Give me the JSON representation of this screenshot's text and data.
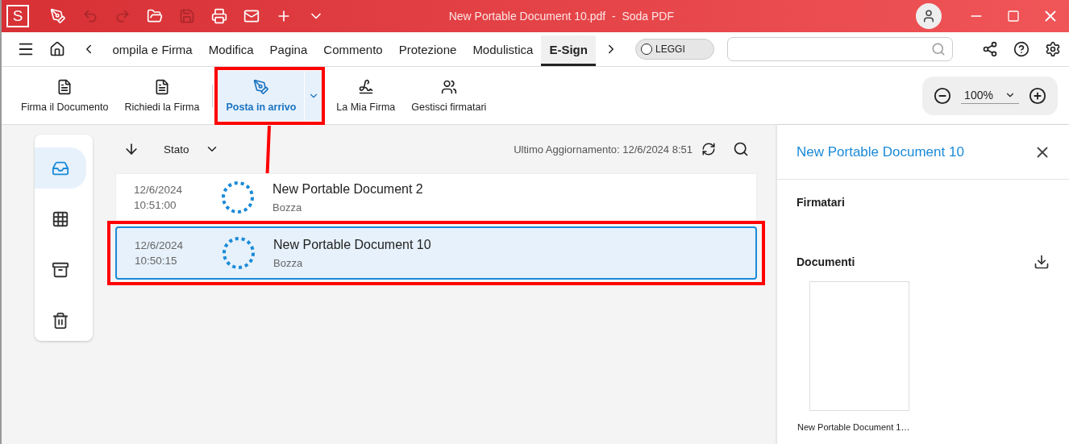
{
  "title_bar": {
    "logo": "S",
    "title": "New Portable Document 10.pdf  -  Soda PDF"
  },
  "tabs": [
    {
      "label": "ompila e Firma",
      "selected": false
    },
    {
      "label": "Modifica",
      "selected": false
    },
    {
      "label": "Pagina",
      "selected": false
    },
    {
      "label": "Commento",
      "selected": false
    },
    {
      "label": "Protezione",
      "selected": false
    },
    {
      "label": "Modulistica",
      "selected": false
    },
    {
      "label": "E-Sign",
      "selected": true
    }
  ],
  "read_mode": {
    "label": "LEGGI",
    "on": false
  },
  "ribbon": [
    {
      "label": "Firma il Documento",
      "selected": false
    },
    {
      "label": "Richiedi la Firma",
      "selected": false
    },
    {
      "label": "Posta in arrivo",
      "selected": true
    },
    {
      "label": "La Mia Firma",
      "selected": false
    },
    {
      "label": "Gestisci firmatari",
      "selected": false
    }
  ],
  "zoom": {
    "value": "100%"
  },
  "rail": [
    {
      "selected": true
    },
    {
      "selected": false
    },
    {
      "selected": false
    },
    {
      "selected": false
    }
  ],
  "list_toolbar": {
    "sort": "Stato",
    "updated": "Ultimo Aggiornamento:  12/6/2024 8:51"
  },
  "rows": [
    {
      "date": "12/6/2024",
      "time": "10:51:00",
      "title": "New Portable Document 2",
      "status": "Bozza",
      "selected": false
    },
    {
      "date": "12/6/2024",
      "time": "10:50:15",
      "title": "New Portable Document 10",
      "status": "Bozza",
      "selected": true
    }
  ],
  "panel": {
    "title": "New Portable Document 10",
    "signers_heading": "Firmatari",
    "documents_heading": "Documenti",
    "file_name": "New Portable Document 1…"
  }
}
